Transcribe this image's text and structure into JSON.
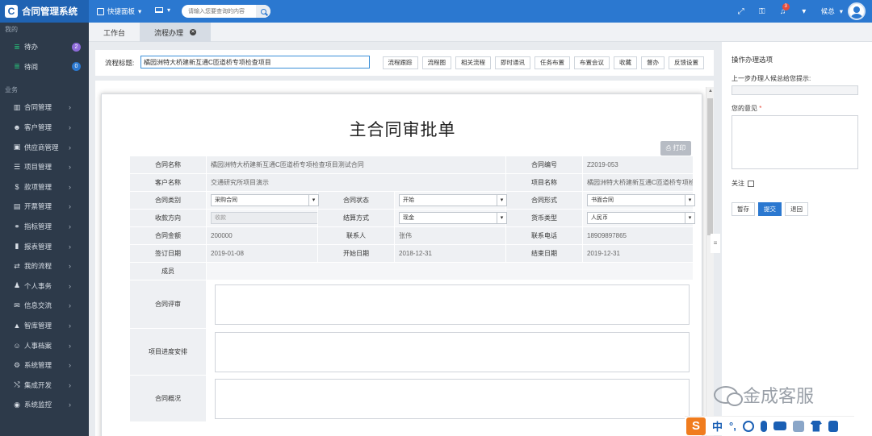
{
  "app": {
    "title": "合同管理系统",
    "logo_letter": "C"
  },
  "header": {
    "quick_panel": "快捷面板",
    "search_placeholder": "请输入您要查询的内容",
    "notification_count": "3",
    "user_name": "候总"
  },
  "sidebar": {
    "section_mine": "我的",
    "todo": {
      "label": "待办",
      "count": "2"
    },
    "toread": {
      "label": "待阅",
      "count": "0"
    },
    "section_business": "业务",
    "items": [
      {
        "label": "合同管理",
        "icon": "book-icon"
      },
      {
        "label": "客户管理",
        "icon": "users-icon"
      },
      {
        "label": "供应商管理",
        "icon": "briefcase-icon"
      },
      {
        "label": "项目管理",
        "icon": "list-icon"
      },
      {
        "label": "款项管理",
        "icon": "dollar-icon"
      },
      {
        "label": "开票管理",
        "icon": "invoice-icon"
      },
      {
        "label": "指标管理",
        "icon": "link-icon"
      },
      {
        "label": "报表管理",
        "icon": "bar-chart-icon"
      },
      {
        "label": "我的流程",
        "icon": "exchange-icon"
      },
      {
        "label": "个人事务",
        "icon": "person-icon"
      },
      {
        "label": "信息交流",
        "icon": "comment-icon"
      },
      {
        "label": "智库管理",
        "icon": "graduation-cap-icon"
      },
      {
        "label": "人事档案",
        "icon": "group-icon"
      },
      {
        "label": "系统管理",
        "icon": "cog-icon"
      },
      {
        "label": "集成开发",
        "icon": "shuffle-icon"
      },
      {
        "label": "系统监控",
        "icon": "eye-icon"
      }
    ]
  },
  "tabs": [
    {
      "label": "工作台"
    },
    {
      "label": "流程办理"
    }
  ],
  "flow": {
    "title_label": "流程标题:",
    "title_value": "橘园洲特大桥建新互通C匝道桥专项检查项目",
    "buttons": [
      "流程跟踪",
      "流程图",
      "相关流程",
      "即时通讯",
      "任务布置",
      "布置会议",
      "收藏",
      "督办",
      "反馈设置"
    ]
  },
  "form": {
    "title": "主合同审批单",
    "print_label": "打印",
    "contract_name_label": "合同名称",
    "contract_name": "橘园洲特大桥建新互通C匝道桥专项检查项目测试合同",
    "contract_no_label": "合同编号",
    "contract_no": "Z2019-053",
    "customer_label": "客户名称",
    "customer": "交通研究所项目演示",
    "project_label": "项目名称",
    "project": "橘园洲特大桥建新互通C匝道桥专项检查",
    "category_label": "合同类别",
    "category": "采购合同",
    "status_label": "合同状态",
    "status": "开始",
    "form_label": "合同形式",
    "form_value": "书面合同",
    "direction_label": "收款方向",
    "direction": "收款",
    "settle_label": "结算方式",
    "settle": "现金",
    "currency_label": "货币类型",
    "currency": "人民币",
    "amount_label": "合同金额",
    "amount": "200000",
    "contact_label": "联系人",
    "contact": "张伟",
    "phone_label": "联系电话",
    "phone": "18909897865",
    "sign_date_label": "签订日期",
    "sign_date": "2019-01-08",
    "start_date_label": "开始日期",
    "start_date": "2018-12-31",
    "end_date_label": "结束日期",
    "end_date": "2019-12-31",
    "members_label": "成员",
    "review_label": "合同评审",
    "schedule_label": "项目进度安排",
    "overview_label": "合同概况"
  },
  "right_panel": {
    "title": "操作办理选项",
    "prev_hint": "上一步办理人候总给您提示:",
    "opinion_label": "您的意见",
    "required_mark": "*",
    "follow_label": "关注",
    "save_label": "暂存",
    "submit_label": "提交",
    "return_label": "退回"
  },
  "watermark": {
    "text": "金成客服"
  },
  "ime": {
    "logo": "S",
    "lang": "中",
    "punct": "°,"
  }
}
